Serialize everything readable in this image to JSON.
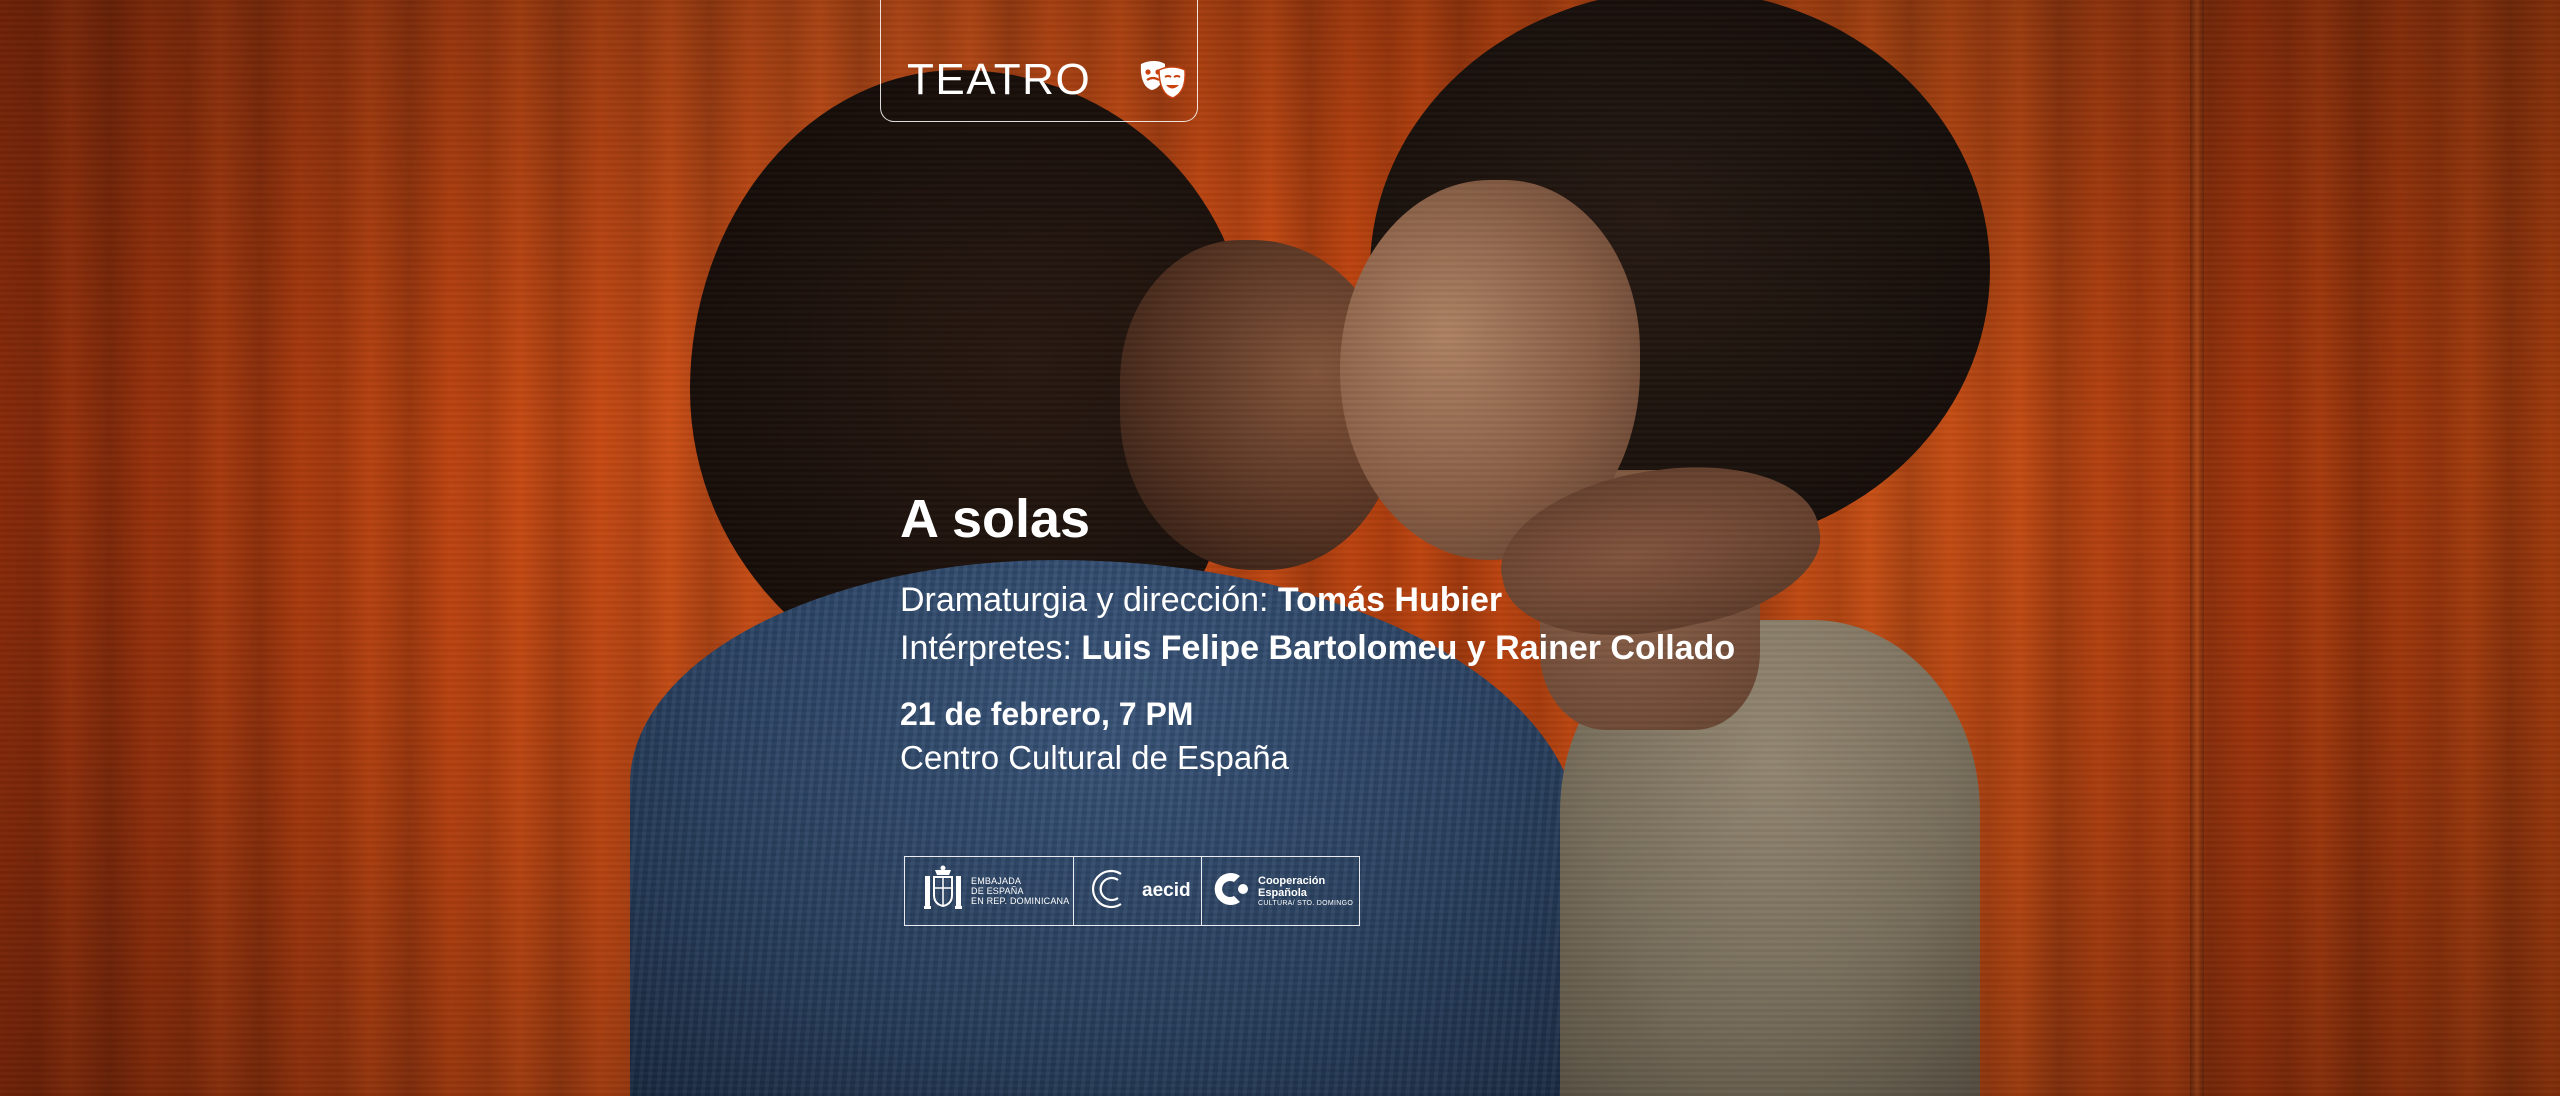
{
  "category_tag": {
    "label": "TEATRO",
    "icon": "theater-masks-icon"
  },
  "event": {
    "title": "A solas",
    "direction_label": "Dramaturgia y dirección: ",
    "director": "Tomás Hubier",
    "performers_label": "Intérpretes: ",
    "performers": "Luis Felipe Bartolomeu y Rainer Collado",
    "date": "21 de febrero, 7 PM",
    "venue": "Centro Cultural de España"
  },
  "sponsors": {
    "embajada": {
      "line1": "EMBAJADA",
      "line2": "DE ESPAÑA",
      "line3": "EN REP. DOMINICANA",
      "icon": "coat-of-arms-icon"
    },
    "aecid": {
      "label": "aecid",
      "icon": "aecid-logo-icon"
    },
    "cooperacion": {
      "line1": "Cooperación",
      "line2": "Española",
      "line3": "CULTURA/ STO. DOMINGO",
      "icon": "cooperacion-logo-icon"
    }
  },
  "colors": {
    "curtain": "#c8410f",
    "text": "#ffffff"
  }
}
